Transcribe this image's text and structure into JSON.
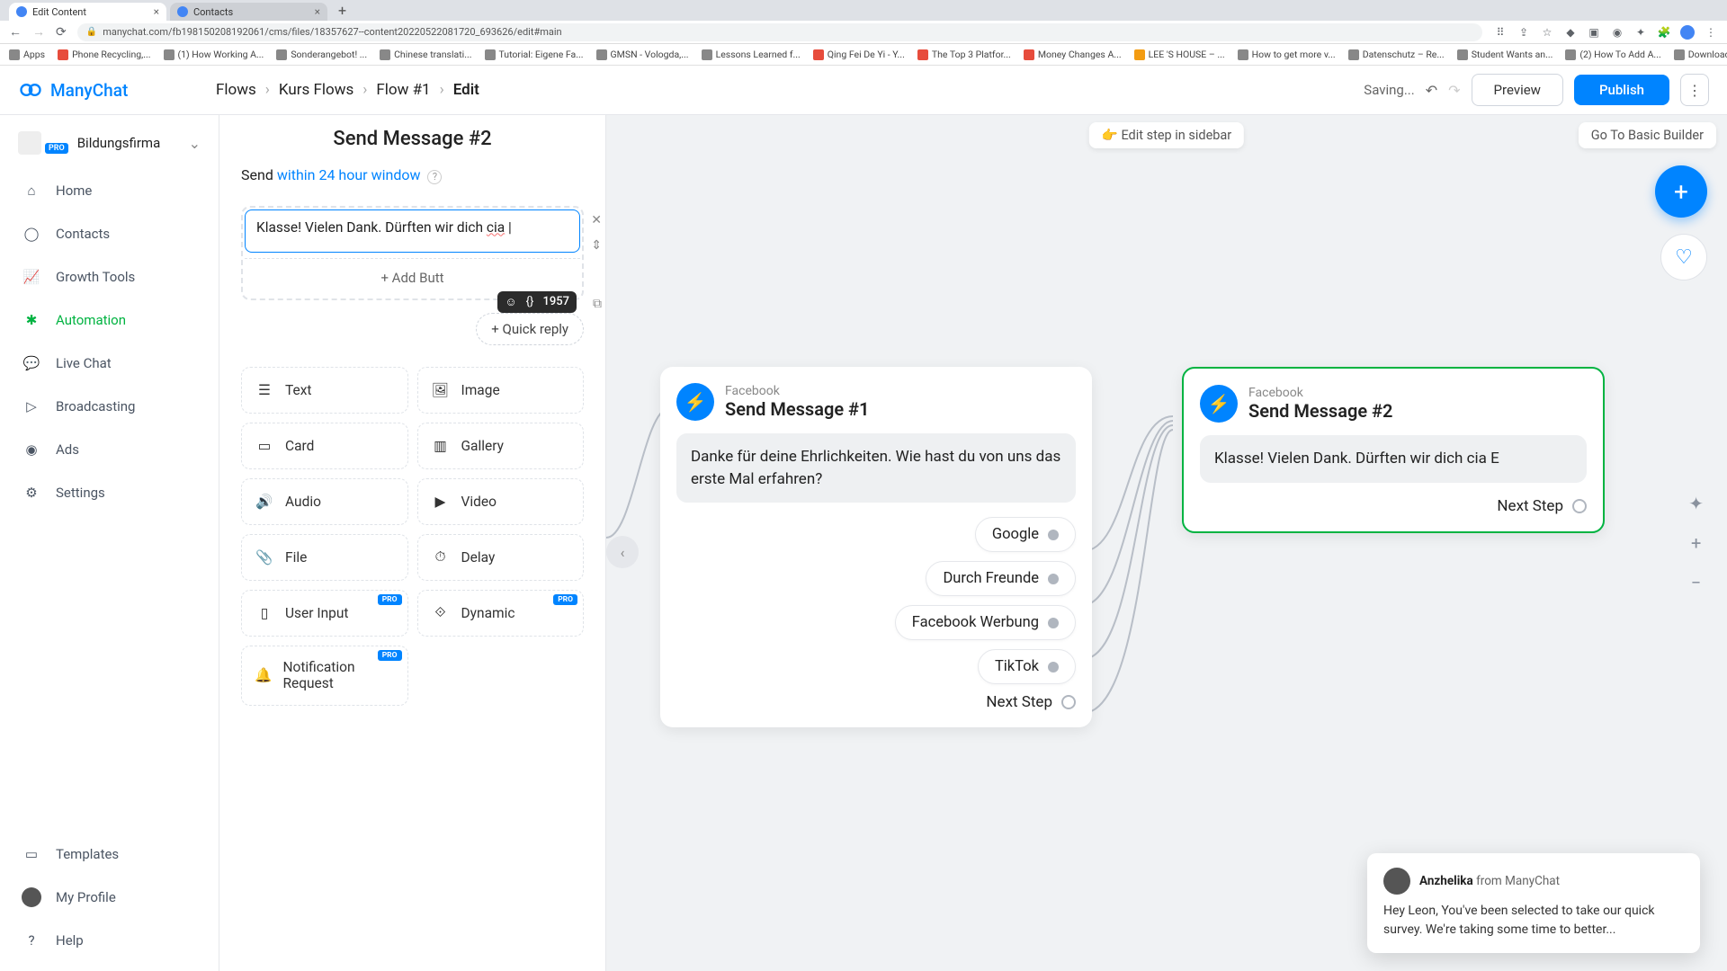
{
  "browser": {
    "tabs": [
      {
        "title": "Edit Content",
        "active": true
      },
      {
        "title": "Contacts",
        "active": false
      }
    ],
    "url": "manychat.com/fb198150208192061/cms/files/18357627--content20220522081720_693626/edit#main",
    "bookmarks": [
      "Apps",
      "Phone Recycling,...",
      "(1) How Working A...",
      "Sonderangebot! ...",
      "Chinese translati...",
      "Tutorial: Eigene Fa...",
      "GMSN - Vologda,...",
      "Lessons Learned f...",
      "Qing Fei De Yi - Y...",
      "The Top 3 Platfor...",
      "Money Changes A...",
      "LEE 'S HOUSE – ...",
      "How to get more v...",
      "Datenschutz – Re...",
      "Student Wants an...",
      "(2) How To Add A...",
      "Download - Cooki..."
    ]
  },
  "brand": "ManyChat",
  "breadcrumbs": {
    "items": [
      "Flows",
      "Kurs Flows",
      "Flow #1",
      "Edit"
    ]
  },
  "header": {
    "saving": "Saving...",
    "preview": "Preview",
    "publish": "Publish"
  },
  "account": {
    "name": "Bildungsfirma",
    "badge": "PRO"
  },
  "sidebar": {
    "items": [
      {
        "label": "Home"
      },
      {
        "label": "Contacts"
      },
      {
        "label": "Growth Tools"
      },
      {
        "label": "Automation",
        "active": true
      },
      {
        "label": "Live Chat"
      },
      {
        "label": "Broadcasting"
      },
      {
        "label": "Ads"
      },
      {
        "label": "Settings"
      }
    ],
    "bottom": [
      {
        "label": "Templates"
      },
      {
        "label": "My Profile"
      },
      {
        "label": "Help"
      }
    ]
  },
  "editor": {
    "title": "Send Message #2",
    "send_label": "Send",
    "send_window": "within 24 hour window",
    "text_value": "Klasse! Vielen Dank. Dürften wir dich cia ",
    "underlined_word": "cia",
    "char_count": "1957",
    "add_button": "+ Add Butt",
    "quick_reply": "+ Quick reply",
    "palette": [
      {
        "label": "Text"
      },
      {
        "label": "Image"
      },
      {
        "label": "Card"
      },
      {
        "label": "Gallery"
      },
      {
        "label": "Audio"
      },
      {
        "label": "Video"
      },
      {
        "label": "File"
      },
      {
        "label": "Delay"
      },
      {
        "label": "User Input",
        "pro": true
      },
      {
        "label": "Dynamic",
        "pro": true
      },
      {
        "label": "Notification Request",
        "pro": true
      }
    ]
  },
  "canvas": {
    "edit_sidebar": "Edit step in sidebar",
    "go_basic": "Go To Basic Builder",
    "node1": {
      "platform": "Facebook",
      "title": "Send Message #1",
      "message": "Danke für deine Ehrlichkeiten. Wie hast du von uns das erste Mal erfahren?",
      "choices": [
        "Google",
        "Durch Freunde",
        "Facebook Werbung",
        "TikTok"
      ],
      "next": "Next Step"
    },
    "node2": {
      "platform": "Facebook",
      "title": "Send Message #2",
      "message": "Klasse! Vielen Dank. Dürften wir dich cia E",
      "next": "Next Step"
    }
  },
  "chat": {
    "sender": "Anzhelika",
    "from": " from ManyChat",
    "body": "Hey Leon,  You've been selected to take our quick survey. We're taking some time to better..."
  }
}
